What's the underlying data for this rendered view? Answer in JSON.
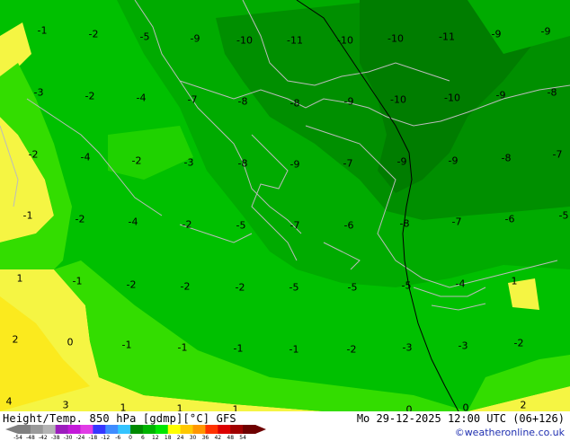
{
  "map": {
    "colors": {
      "sea_yellow": "#f5f543",
      "bright_yellow": "#ffff00",
      "light_green": "#33dd00",
      "green": "#00c000",
      "green_mid": "#00ab00",
      "dark_green": "#008f00",
      "darker_green": "#007d00",
      "border_gray": "#bcbcbc",
      "front_line": "#000000"
    },
    "contour_labels": [
      {
        "text": "-1"
      },
      {
        "text": "-2"
      },
      {
        "text": "-5"
      },
      {
        "text": "-9"
      },
      {
        "text": "-10"
      },
      {
        "text": "-11"
      },
      {
        "text": "-10"
      },
      {
        "text": "-10"
      },
      {
        "text": "-11"
      },
      {
        "text": "-9"
      },
      {
        "text": "-9"
      },
      {
        "text": "-3"
      },
      {
        "text": "-2"
      },
      {
        "text": "-4"
      },
      {
        "text": "-7"
      },
      {
        "text": "-8"
      },
      {
        "text": "-8"
      },
      {
        "text": "-9"
      },
      {
        "text": "-10"
      },
      {
        "text": "-10"
      },
      {
        "text": "-9"
      },
      {
        "text": "-8"
      },
      {
        "text": "-2"
      },
      {
        "text": "-4"
      },
      {
        "text": "-2"
      },
      {
        "text": "-3"
      },
      {
        "text": "-8"
      },
      {
        "text": "-9"
      },
      {
        "text": "-7"
      },
      {
        "text": "-9"
      },
      {
        "text": "-9"
      },
      {
        "text": "-8"
      },
      {
        "text": "-7"
      },
      {
        "text": "-1"
      },
      {
        "text": "-2"
      },
      {
        "text": "-4"
      },
      {
        "text": "-2"
      },
      {
        "text": "-5"
      },
      {
        "text": "-7"
      },
      {
        "text": "-6"
      },
      {
        "text": "-8"
      },
      {
        "text": "-7"
      },
      {
        "text": "-6"
      },
      {
        "text": "-5"
      },
      {
        "text": "1"
      },
      {
        "text": "-1"
      },
      {
        "text": "-2"
      },
      {
        "text": "-2"
      },
      {
        "text": "-2"
      },
      {
        "text": "-5"
      },
      {
        "text": "-5"
      },
      {
        "text": "-5"
      },
      {
        "text": "-4"
      },
      {
        "text": "1"
      },
      {
        "text": "2"
      },
      {
        "text": "0"
      },
      {
        "text": "-1"
      },
      {
        "text": "-1"
      },
      {
        "text": "-1"
      },
      {
        "text": "-1"
      },
      {
        "text": "-2"
      },
      {
        "text": "-3"
      },
      {
        "text": "-3"
      },
      {
        "text": "-2"
      },
      {
        "text": "4"
      },
      {
        "text": "3"
      },
      {
        "text": "1"
      },
      {
        "text": "1"
      },
      {
        "text": "1"
      },
      {
        "text": "0"
      },
      {
        "text": "0"
      },
      {
        "text": "2"
      }
    ]
  },
  "footer": {
    "title": "Height/Temp. 850 hPa [gdmp][°C] GFS",
    "datetime": "Mo 29-12-2025 12:00 UTC (06+126)",
    "credit": "©weatheronline.co.uk",
    "colorbar": {
      "ticks": [
        "-54",
        "-48",
        "-42",
        "-38",
        "-30",
        "-24",
        "-18",
        "-12",
        "-6",
        "0",
        "6",
        "12",
        "18",
        "24",
        "30",
        "36",
        "42",
        "48",
        "54"
      ],
      "colors": [
        "#7f7f7f",
        "#9a9a9a",
        "#b4b4b4",
        "#9c1dbd",
        "#c319d9",
        "#e13ce6",
        "#3636ff",
        "#3f8cff",
        "#35c4ff",
        "#008a00",
        "#00b400",
        "#00e600",
        "#ffff00",
        "#ffc800",
        "#ff9600",
        "#ff3200",
        "#dc0000",
        "#a00000",
        "#6e0000"
      ]
    }
  }
}
